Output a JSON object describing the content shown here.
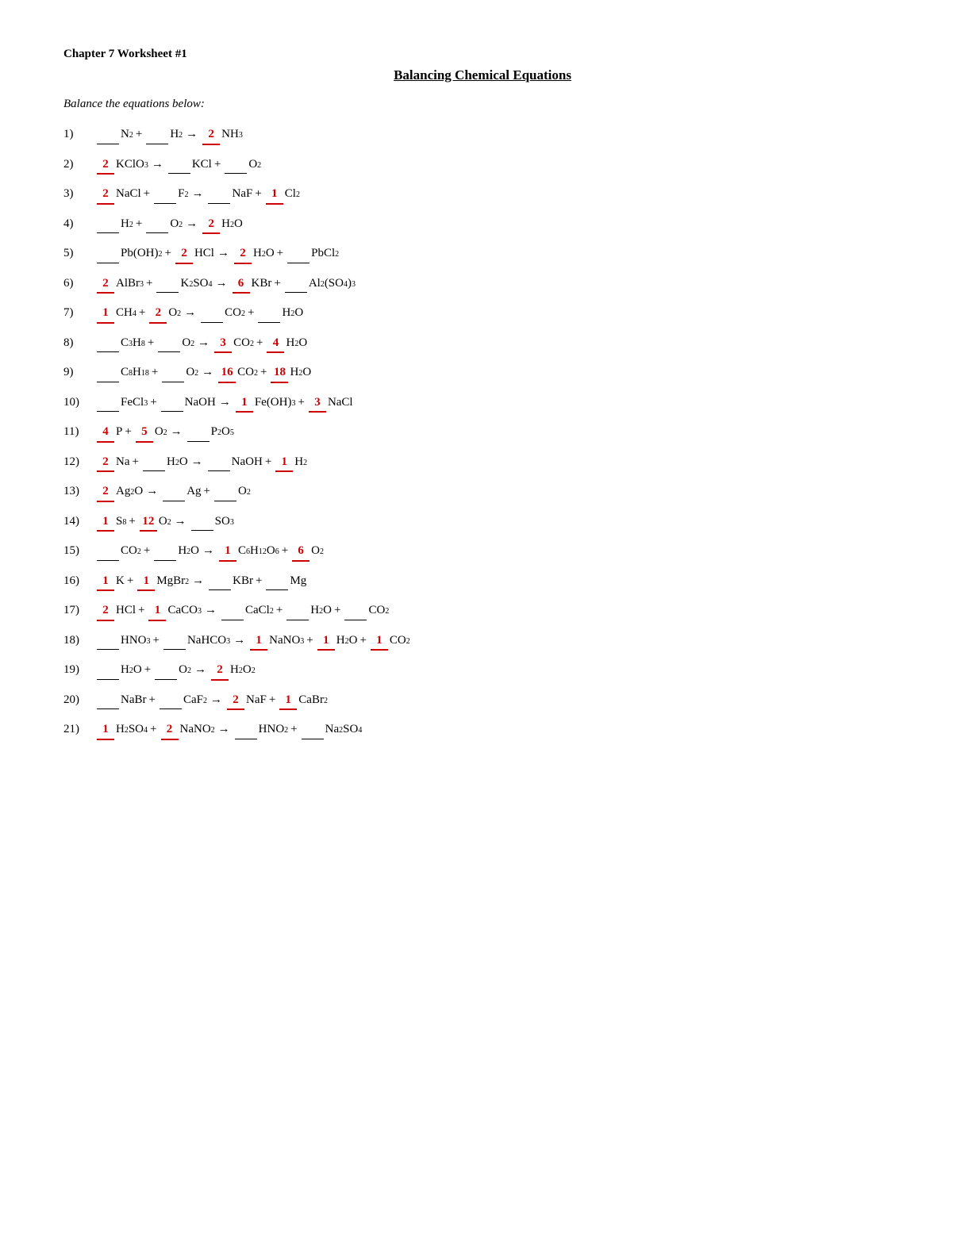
{
  "header": {
    "chapter": "Chapter 7 Worksheet #1",
    "title": "Balancing Chemical Equations",
    "instruction": "Balance the equations below:"
  },
  "equations": [
    {
      "num": "1)",
      "display": "eq1"
    },
    {
      "num": "2)",
      "display": "eq2"
    },
    {
      "num": "3)",
      "display": "eq3"
    },
    {
      "num": "4)",
      "display": "eq4"
    },
    {
      "num": "5)",
      "display": "eq5"
    },
    {
      "num": "6)",
      "display": "eq6"
    },
    {
      "num": "7)",
      "display": "eq7"
    },
    {
      "num": "8)",
      "display": "eq8"
    },
    {
      "num": "9)",
      "display": "eq9"
    },
    {
      "num": "10)",
      "display": "eq10"
    },
    {
      "num": "11)",
      "display": "eq11"
    },
    {
      "num": "12)",
      "display": "eq12"
    },
    {
      "num": "13)",
      "display": "eq13"
    },
    {
      "num": "14)",
      "display": "eq14"
    },
    {
      "num": "15)",
      "display": "eq15"
    },
    {
      "num": "16)",
      "display": "eq16"
    },
    {
      "num": "17)",
      "display": "eq17"
    },
    {
      "num": "18)",
      "display": "eq18"
    },
    {
      "num": "19)",
      "display": "eq19"
    },
    {
      "num": "20)",
      "display": "eq20"
    },
    {
      "num": "21)",
      "display": "eq21"
    }
  ]
}
